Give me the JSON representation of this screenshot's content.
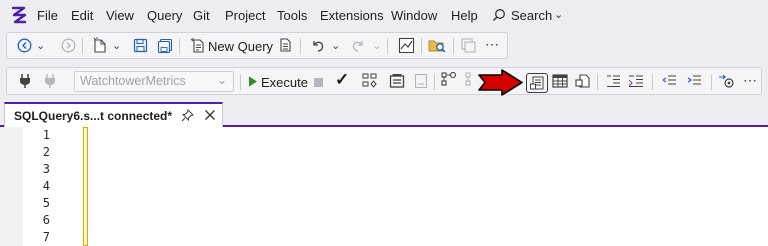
{
  "menu": {
    "items": [
      "File",
      "Edit",
      "View",
      "Query",
      "Git",
      "Project",
      "Tools",
      "Extensions",
      "Window",
      "Help"
    ],
    "search_label": "Search"
  },
  "toolbar1": {
    "new_query_label": "New Query"
  },
  "toolbar2": {
    "database_value": "WatchtowerMetrics",
    "execute_label": "Execute"
  },
  "tab": {
    "title": "SQLQuery6.s...t connected*"
  },
  "editor": {
    "line_numbers": [
      "1",
      "2",
      "3",
      "4",
      "5",
      "6",
      "7"
    ]
  },
  "colors": {
    "accent": "#4b1fa8",
    "execute_green": "#2e8b2e",
    "arrow_red": "#d40000",
    "change_bar": "#e0a800"
  }
}
